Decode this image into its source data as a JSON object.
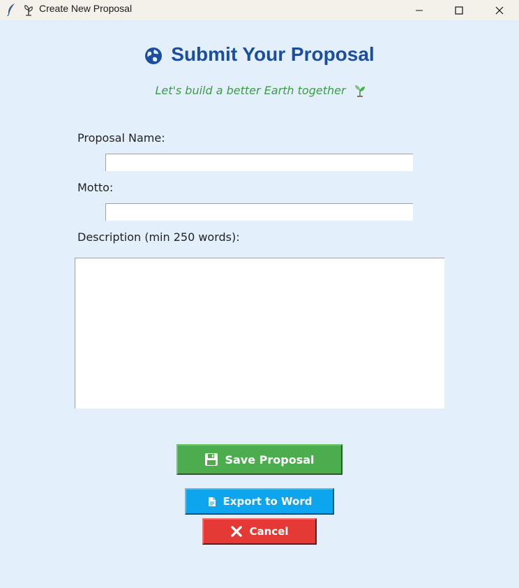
{
  "window": {
    "title": "Create New Proposal",
    "app_icon": "feather-icon",
    "secondary_icon": "sprout-icon"
  },
  "header": {
    "title": "Submit Your Proposal",
    "title_icon": "globe-icon",
    "subtitle": "Let's build a better Earth together",
    "subtitle_icon": "seedling-icon",
    "title_color": "#1c4ea0",
    "subtitle_color": "#3c9a4a"
  },
  "form": {
    "name_label": "Proposal Name:",
    "name_value": "",
    "motto_label": "Motto:",
    "motto_value": "",
    "description_label": "Description (min 250 words):",
    "description_value": ""
  },
  "buttons": {
    "save": {
      "label": "Save Proposal",
      "icon": "floppy-disk-icon",
      "color": "#4cad4e"
    },
    "export": {
      "label": "Export to Word",
      "icon": "document-icon",
      "color": "#0ea5ef"
    },
    "cancel": {
      "label": "Cancel",
      "icon": "close-icon",
      "color": "#e53935"
    }
  },
  "colors": {
    "background": "#e3f0fb",
    "titlebar": "#f4f1ea"
  }
}
